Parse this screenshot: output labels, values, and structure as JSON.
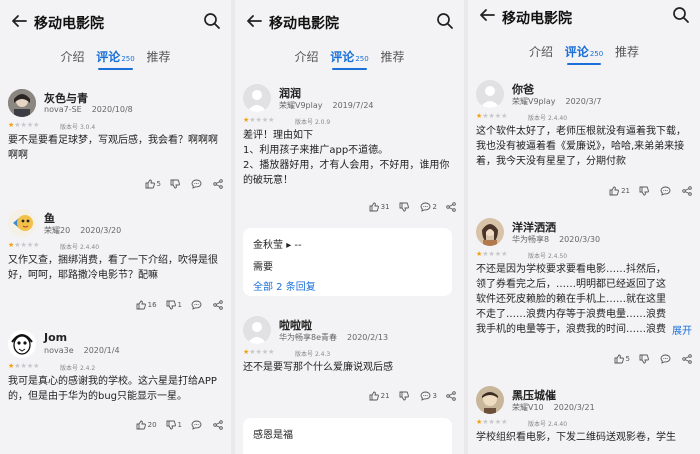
{
  "app_title": "移动电影院",
  "tabs": {
    "intro": "介绍",
    "comments": "评论",
    "comments_count": "250",
    "recommend": "推荐"
  },
  "version_prefix": "版本号",
  "colors": {
    "accent": "#1a6fd8",
    "star": "#f2a20c"
  },
  "panels": [
    {
      "reviews": [
        {
          "user": "灰色与青",
          "device": "nova7-SE",
          "date": "2020/10/8",
          "rating": 1,
          "version": "3.0.4",
          "text": "要不是要看足球梦，写观后感，我会看？啊啊啊啊啊",
          "likes": "5",
          "dislikes": "",
          "comments": ""
        },
        {
          "user": "鱼",
          "device": "荣耀20",
          "date": "2020/3/20",
          "rating": 1,
          "version": "2.4.40",
          "text": "又作又查，捆绑消费，看了一下介绍，吹得是很好，呵呵，耶路撒冷电影节？配嘛",
          "likes": "16",
          "dislikes": "1",
          "comments": ""
        },
        {
          "user": "Jom",
          "device": "nova3e",
          "date": "2020/1/4",
          "rating": 1,
          "version": "2.4.2",
          "text": "我可是真心的感谢我的学校。这六星是打给APP的，但是由于华为的bug只能显示一星。",
          "likes": "20",
          "dislikes": "1",
          "comments": ""
        }
      ]
    },
    {
      "reviews": [
        {
          "user": "润润",
          "device": "荣耀V9play",
          "date": "2019/7/24",
          "rating": 1,
          "version": "2.0.9",
          "text_lines": [
            "差评！理由如下",
            "1、利用孩子来推广app不道德。",
            "2、播放器好用，才有人会用，不好用，谁用你的破玩意！"
          ],
          "likes": "31",
          "dislikes": "",
          "comments": "2",
          "reply": {
            "user": "金秋莹",
            "arrow": "▸ --",
            "text": "需要",
            "more": "全部 2 条回复"
          }
        },
        {
          "user": "啦啦啦",
          "device": "华为畅享8e青春",
          "date": "2020/2/13",
          "rating": 1,
          "version": "2.4.3",
          "text": "还不是要写那个什么爱廉说观后感",
          "likes": "21",
          "dislikes": "",
          "comments": "3",
          "reply": {
            "user": "感恩是福"
          }
        }
      ]
    },
    {
      "reviews": [
        {
          "user": "你爸",
          "device": "荣耀V9play",
          "date": "2020/3/7",
          "rating": 1,
          "version": "2.4.40",
          "text": "这个软件太好了，老师压根就没有逼着我下载，我也没有被逼着看《爱廉说》，哈哈,来弟弟来接着，我今天没有星星了，分期付款",
          "likes": "21",
          "dislikes": "",
          "comments": ""
        },
        {
          "user": "洋洋洒洒",
          "device": "华为畅享8",
          "date": "2020/3/30",
          "rating": 1,
          "version": "2.4.50",
          "text": "不还是因为学校要求要看电影……抖然后，领了券看完之后，……明明都已经返回了这软件还死皮赖脸的赖在手机上……就在这里不走了……浪费内存等于浪费电量……浪费我手机的电量等于，浪费我的时间……浪费时间等于浪费金钱…",
          "expand": "展开",
          "likes": "5",
          "dislikes": "",
          "comments": ""
        },
        {
          "user": "黑压城催",
          "device": "荣耀V10",
          "date": "2020/3/21",
          "rating": 1,
          "version": "2.4.40",
          "text": "学校组织看电影，下发二维码送观影卷，学生"
        }
      ]
    }
  ]
}
